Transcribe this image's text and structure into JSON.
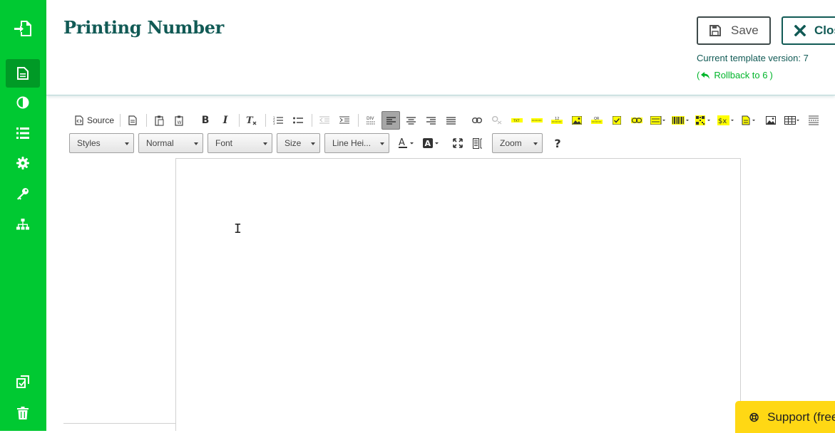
{
  "page": {
    "title": "Printing Number"
  },
  "sidebar": {
    "items": [
      {
        "icon": "file-export-icon"
      },
      {
        "icon": "document-icon",
        "active": true
      },
      {
        "icon": "contrast-icon"
      },
      {
        "icon": "list-icon"
      },
      {
        "icon": "gear-icon"
      },
      {
        "icon": "key-icon"
      },
      {
        "icon": "sitemap-icon"
      },
      {
        "icon": "copy-icon"
      },
      {
        "icon": "trash-icon"
      }
    ]
  },
  "header": {
    "save_label": "Save",
    "close_label": "Close",
    "version_text": "Current template version: 7",
    "rollback_open": "(",
    "rollback_label": "Rollback to 6",
    "rollback_close": ")"
  },
  "toolbar": {
    "source_label": "Source",
    "combos": {
      "styles": "Styles",
      "format": "Normal",
      "font": "Font",
      "size": "Size",
      "line_height": "Line Hei...",
      "zoom": "Zoom"
    },
    "help_label": "?"
  },
  "support": {
    "label": "Support (free)"
  },
  "colors": {
    "brand_green": "#00c932",
    "dark_teal": "#115a55",
    "support_yellow": "#ffd814"
  }
}
